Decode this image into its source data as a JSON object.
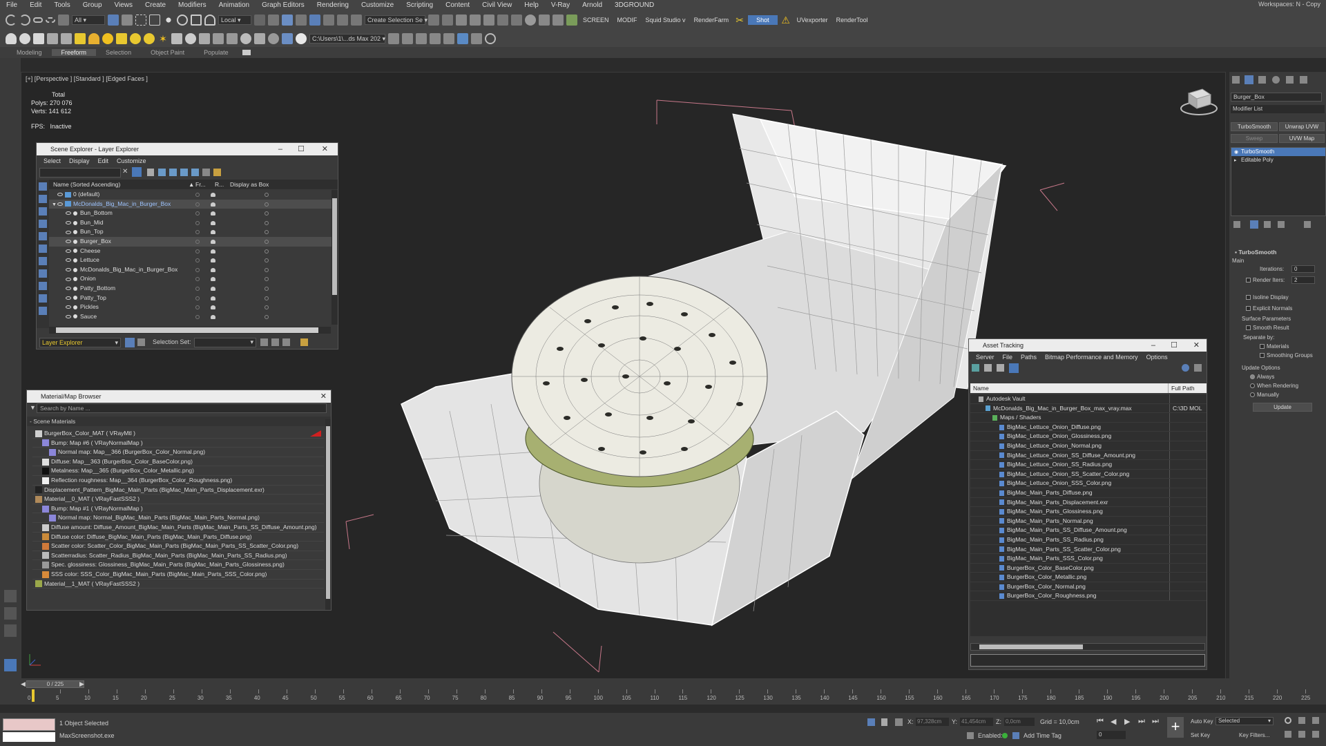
{
  "menubar": [
    "File",
    "Edit",
    "Tools",
    "Group",
    "Views",
    "Create",
    "Modifiers",
    "Animation",
    "Graph Editors",
    "Rendering",
    "Customize",
    "Scripting",
    "Content",
    "Civil View",
    "Help",
    "V-Ray",
    "Arnold",
    "3DGROUND"
  ],
  "workspace": "Workspaces: N - Copy",
  "toolbar1": {
    "filter_all": "All",
    "coord_local": "Local",
    "create_selection_set": "Create Selection Se",
    "screen": "SCREEN",
    "modif": "MODIF",
    "squid": "Squid Studio v",
    "renderfarm": "RenderFarm",
    "shot": "Shot",
    "uvexporter": "UVexporter",
    "rendertool": "RenderTool"
  },
  "toolbar2": {
    "path": "C:\\Users\\1\\...ds Max 202"
  },
  "ribbon_tabs": [
    {
      "label": "Modeling",
      "active": false
    },
    {
      "label": "Freeform",
      "active": true
    },
    {
      "label": "Selection",
      "active": false
    },
    {
      "label": "Object Paint",
      "active": false
    },
    {
      "label": "Populate",
      "active": false
    }
  ],
  "viewport": {
    "label": "[+] [Perspective ] [Standard ] [Edged Faces ]",
    "total": "Total",
    "polys_label": "Polys:",
    "polys": "270 076",
    "verts_label": "Verts:",
    "verts": "141 612",
    "fps_label": "FPS:",
    "fps": "Inactive"
  },
  "scene_explorer": {
    "title": "Scene Explorer - Layer Explorer",
    "menu": [
      "Select",
      "Display",
      "Edit",
      "Customize"
    ],
    "col_name": "Name (Sorted Ascending)",
    "col_fr": "Fr...",
    "col_r": "R...",
    "col_display": "Display as Box",
    "rows": [
      {
        "name": "0 (default)",
        "indent": 1,
        "selected": false,
        "layer": true
      },
      {
        "name": "McDonalds_Big_Mac_in_Burger_Box",
        "indent": 1,
        "selected": true,
        "layer": true
      },
      {
        "name": "Bun_Bottom",
        "indent": 2,
        "selected": false,
        "layer": false
      },
      {
        "name": "Bun_Mid",
        "indent": 2,
        "selected": false,
        "layer": false
      },
      {
        "name": "Bun_Top",
        "indent": 2,
        "selected": false,
        "layer": false
      },
      {
        "name": "Burger_Box",
        "indent": 2,
        "selected": true,
        "layer": false
      },
      {
        "name": "Cheese",
        "indent": 2,
        "selected": false,
        "layer": false
      },
      {
        "name": "Lettuce",
        "indent": 2,
        "selected": false,
        "layer": false
      },
      {
        "name": "McDonalds_Big_Mac_in_Burger_Box",
        "indent": 2,
        "selected": false,
        "layer": false
      },
      {
        "name": "Onion",
        "indent": 2,
        "selected": false,
        "layer": false
      },
      {
        "name": "Patty_Bottom",
        "indent": 2,
        "selected": false,
        "layer": false
      },
      {
        "name": "Patty_Top",
        "indent": 2,
        "selected": false,
        "layer": false
      },
      {
        "name": "Pickles",
        "indent": 2,
        "selected": false,
        "layer": false
      },
      {
        "name": "Sauce",
        "indent": 2,
        "selected": false,
        "layer": false
      }
    ],
    "footer_dropdown": "Layer Explorer",
    "selection_set_label": "Selection Set:"
  },
  "material_browser": {
    "title": "Material/Map Browser",
    "search_placeholder": "Search by Name ...",
    "section": "- Scene Materials",
    "rows": [
      {
        "text": "BurgerBox_Color_MAT  ( VRayMtl )",
        "indent": 0,
        "thumb": "#cfcfcf",
        "flag": true
      },
      {
        "text": "Bump: Map #6  ( VRayNormalMap )",
        "indent": 1,
        "thumb": "#8b86d9",
        "flag": false
      },
      {
        "text": "Normal map: Map__366 (BurgerBox_Color_Normal.png)",
        "indent": 2,
        "thumb": "#8b86d9",
        "flag": false
      },
      {
        "text": "Diffuse: Map__363 (BurgerBox_Color_BaseColor.png)",
        "indent": 1,
        "thumb": "#e0e0e0",
        "flag": false
      },
      {
        "text": "Metalness: Map__365 (BurgerBox_Color_Metallic.png)",
        "indent": 1,
        "thumb": "#111111",
        "flag": false
      },
      {
        "text": "Reflection roughness: Map__364 (BurgerBox_Color_Roughness.png)",
        "indent": 1,
        "thumb": "#f0f0f0",
        "flag": false
      },
      {
        "text": "Displacement_Pattern_BigMac_Main_Parts (BigMac_Main_Parts_Displacement.exr)",
        "indent": 0,
        "thumb": "#222222",
        "flag": false
      },
      {
        "text": "Material__0_MAT  ( VRayFastSSS2 )",
        "indent": 0,
        "thumb": "#b08a5a",
        "flag": false
      },
      {
        "text": "Bump: Map #1  ( VRayNormalMap )",
        "indent": 1,
        "thumb": "#8b86d9",
        "flag": false
      },
      {
        "text": "Normal map: Normal_BigMac_Main_Parts (BigMac_Main_Parts_Normal.png)",
        "indent": 2,
        "thumb": "#8b86d9",
        "flag": false
      },
      {
        "text": "Diffuse amount: Diffuse_Amount_BigMac_Main_Parts (BigMac_Main_Parts_SS_Diffuse_Amount.png)",
        "indent": 1,
        "thumb": "#cccccc",
        "flag": false
      },
      {
        "text": "Diffuse color: Diffuse_BigMac_Main_Parts (BigMac_Main_Parts_Diffuse.png)",
        "indent": 1,
        "thumb": "#c98a3a",
        "flag": false
      },
      {
        "text": "Scatter color: Scatter_Color_BigMac_Main_Parts (BigMac_Main_Parts_SS_Scatter_Color.png)",
        "indent": 1,
        "thumb": "#d07a3a",
        "flag": false
      },
      {
        "text": "Scatterradius: Scatter_Radius_BigMac_Main_Parts (BigMac_Main_Parts_SS_Radius.png)",
        "indent": 1,
        "thumb": "#bbbbbb",
        "flag": false
      },
      {
        "text": "Spec. glossiness: Glossiness_BigMac_Main_Parts (BigMac_Main_Parts_Glossiness.png)",
        "indent": 1,
        "thumb": "#999999",
        "flag": false
      },
      {
        "text": "SSS color: SSS_Color_BigMac_Main_Parts (BigMac_Main_Parts_SSS_Color.png)",
        "indent": 1,
        "thumb": "#d88a3a",
        "flag": false
      },
      {
        "text": "Material__1_MAT  ( VRayFastSSS2 )",
        "indent": 0,
        "thumb": "#9aa84a",
        "flag": false
      }
    ]
  },
  "asset_tracking": {
    "title": "Asset Tracking",
    "menu": [
      "Server",
      "File",
      "Paths",
      "Bitmap Performance and Memory",
      "Options"
    ],
    "col_name": "Name",
    "col_path": "Full Path",
    "rows": [
      {
        "name": "Autodesk Vault",
        "indent": 0,
        "path": ""
      },
      {
        "name": "McDonalds_Big_Mac_in_Burger_Box_max_vray.max",
        "indent": 1,
        "path": "C:\\3D MOL"
      },
      {
        "name": "Maps / Shaders",
        "indent": 2,
        "path": ""
      },
      {
        "name": "BigMac_Lettuce_Onion_Diffuse.png",
        "indent": 3,
        "path": ""
      },
      {
        "name": "BigMac_Lettuce_Onion_Glossiness.png",
        "indent": 3,
        "path": ""
      },
      {
        "name": "BigMac_Lettuce_Onion_Normal.png",
        "indent": 3,
        "path": ""
      },
      {
        "name": "BigMac_Lettuce_Onion_SS_Diffuse_Amount.png",
        "indent": 3,
        "path": ""
      },
      {
        "name": "BigMac_Lettuce_Onion_SS_Radius.png",
        "indent": 3,
        "path": ""
      },
      {
        "name": "BigMac_Lettuce_Onion_SS_Scatter_Color.png",
        "indent": 3,
        "path": ""
      },
      {
        "name": "BigMac_Lettuce_Onion_SSS_Color.png",
        "indent": 3,
        "path": ""
      },
      {
        "name": "BigMac_Main_Parts_Diffuse.png",
        "indent": 3,
        "path": ""
      },
      {
        "name": "BigMac_Main_Parts_Displacement.exr",
        "indent": 3,
        "path": ""
      },
      {
        "name": "BigMac_Main_Parts_Glossiness.png",
        "indent": 3,
        "path": ""
      },
      {
        "name": "BigMac_Main_Parts_Normal.png",
        "indent": 3,
        "path": ""
      },
      {
        "name": "BigMac_Main_Parts_SS_Diffuse_Amount.png",
        "indent": 3,
        "path": ""
      },
      {
        "name": "BigMac_Main_Parts_SS_Radius.png",
        "indent": 3,
        "path": ""
      },
      {
        "name": "BigMac_Main_Parts_SS_Scatter_Color.png",
        "indent": 3,
        "path": ""
      },
      {
        "name": "BigMac_Main_Parts_SSS_Color.png",
        "indent": 3,
        "path": ""
      },
      {
        "name": "BurgerBox_Color_BaseColor.png",
        "indent": 3,
        "path": ""
      },
      {
        "name": "BurgerBox_Color_Metallic.png",
        "indent": 3,
        "path": ""
      },
      {
        "name": "BurgerBox_Color_Normal.png",
        "indent": 3,
        "path": ""
      },
      {
        "name": "BurgerBox_Color_Roughness.png",
        "indent": 3,
        "path": ""
      }
    ]
  },
  "command_panel": {
    "object_name": "Burger_Box",
    "modifier_list": "Modifier List",
    "buttons": [
      "TurboSmooth",
      "Unwrap UVW",
      "Sweep",
      "UVW Map"
    ],
    "stack": [
      {
        "name": "TurboSmooth",
        "active": true
      },
      {
        "name": "Editable Poly",
        "active": false
      }
    ],
    "rollout_title": "TurboSmooth",
    "main_label": "Main",
    "iterations_label": "Iterations:",
    "iterations": "0",
    "render_iters_label": "Render Iters:",
    "render_iters": "2",
    "isoline": "Isoline Display",
    "explicit": "Explicit Normals",
    "surface_params": "Surface Parameters",
    "smooth_result": "Smooth Result",
    "separate_by": "Separate by:",
    "materials": "Materials",
    "smoothing_groups": "Smoothing Groups",
    "update_options": "Update Options",
    "always": "Always",
    "when_rendering": "When Rendering",
    "manually": "Manually",
    "update_btn": "Update"
  },
  "timeline": {
    "frame_counter": "0 / 225",
    "ticks": [
      "0",
      "5",
      "10",
      "15",
      "20",
      "25",
      "30",
      "35",
      "40",
      "45",
      "50",
      "55",
      "60",
      "65",
      "70",
      "75",
      "80",
      "85",
      "90",
      "95",
      "100",
      "105",
      "110",
      "115",
      "120",
      "125",
      "130",
      "135",
      "140",
      "145",
      "150",
      "155",
      "160",
      "165",
      "170",
      "175",
      "180",
      "185",
      "190",
      "195",
      "200",
      "205",
      "210",
      "215",
      "220",
      "225"
    ]
  },
  "status": {
    "selected": "1 Object Selected",
    "script_listener": "MaxScreenshot.exe",
    "x_label": "X:",
    "x": "97,328cm",
    "y_label": "Y:",
    "y": "41,454cm",
    "z_label": "Z:",
    "z": "0,0cm",
    "grid": "Grid = 10,0cm",
    "enabled": "Enabled:",
    "add_time_tag": "Add Time Tag",
    "autokey": "Auto Key",
    "selected_dropdown": "Selected",
    "setkey": "Set Key",
    "key_filters": "Key Filters...",
    "frame": "0"
  }
}
